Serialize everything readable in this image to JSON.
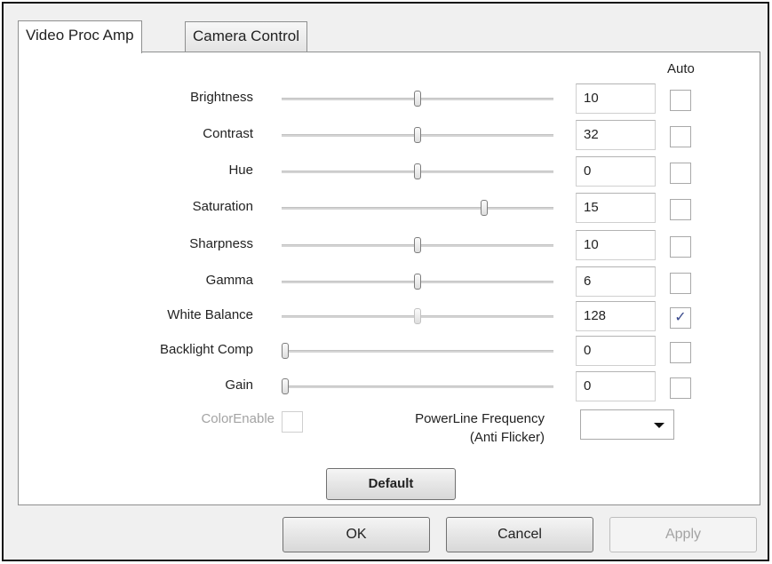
{
  "tabs": [
    {
      "label": "Video Proc Amp",
      "active": true
    },
    {
      "label": "Camera Control",
      "active": false
    }
  ],
  "auto_header": "Auto",
  "controls": [
    {
      "label": "Brightness",
      "value": "10",
      "slider_fraction": 0.5,
      "auto": false
    },
    {
      "label": "Contrast",
      "value": "32",
      "slider_fraction": 0.5,
      "auto": false
    },
    {
      "label": "Hue",
      "value": "0",
      "slider_fraction": 0.5,
      "auto": false
    },
    {
      "label": "Saturation",
      "value": "15",
      "slider_fraction": 0.75,
      "auto": false
    },
    {
      "label": "Sharpness",
      "value": "10",
      "slider_fraction": 0.5,
      "auto": false
    },
    {
      "label": "Gamma",
      "value": "6",
      "slider_fraction": 0.5,
      "auto": false
    },
    {
      "label": "White Balance",
      "value": "128",
      "slider_fraction": 0.5,
      "auto": true,
      "slider_disabled": true
    },
    {
      "label": "Backlight Comp",
      "value": "0",
      "slider_fraction": 0.0,
      "auto": false
    },
    {
      "label": "Gain",
      "value": "0",
      "slider_fraction": 0.0,
      "auto": false
    }
  ],
  "color_enable_label": "ColorEnable",
  "powerline": {
    "line1": "PowerLine Frequency",
    "line2": "(Anti Flicker)",
    "selected": ""
  },
  "buttons": {
    "default": "Default",
    "ok": "OK",
    "cancel": "Cancel",
    "apply": "Apply"
  },
  "check_glyph": "✓",
  "icons": {
    "dropdown": "chevron-down-icon",
    "check": "checkmark-icon"
  }
}
